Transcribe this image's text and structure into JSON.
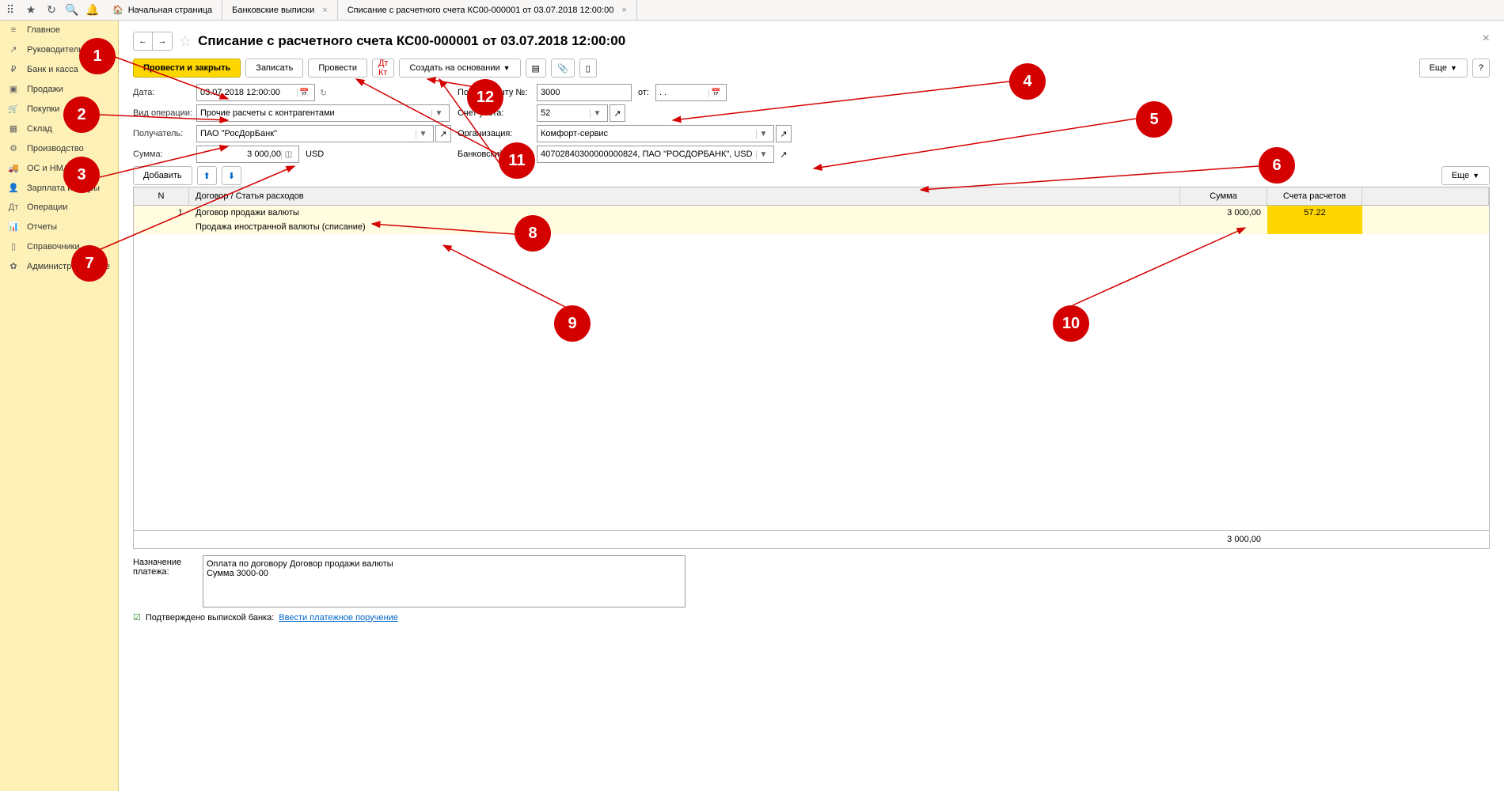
{
  "tabs": {
    "home": "Начальная страница",
    "t1": "Банковские выписки",
    "t2": "Списание с расчетного счета КС00-000001 от 03.07.2018 12:00:00"
  },
  "sidebar": [
    {
      "icon": "≡",
      "label": "Главное"
    },
    {
      "icon": "↗",
      "label": "Руководителю"
    },
    {
      "icon": "₽",
      "label": "Банк и касса"
    },
    {
      "icon": "▣",
      "label": "Продажи"
    },
    {
      "icon": "🛒",
      "label": "Покупки"
    },
    {
      "icon": "▦",
      "label": "Склад"
    },
    {
      "icon": "⚙",
      "label": "Производство"
    },
    {
      "icon": "🚚",
      "label": "ОС и НМА"
    },
    {
      "icon": "👤",
      "label": "Зарплата и кадры"
    },
    {
      "icon": "Дт",
      "label": "Операции"
    },
    {
      "icon": "📊",
      "label": "Отчеты"
    },
    {
      "icon": "▯",
      "label": "Справочники"
    },
    {
      "icon": "✿",
      "label": "Администрирование"
    }
  ],
  "title": "Списание с расчетного счета КС00-000001 от 03.07.2018 12:00:00",
  "toolbar": {
    "post_close": "Провести и закрыть",
    "save": "Записать",
    "post": "Провести",
    "create_based": "Создать на основании",
    "more": "Еще"
  },
  "form": {
    "date_lbl": "Дата:",
    "date": "03.07.2018 12:00:00",
    "op_lbl": "Вид операции:",
    "op": "Прочие расчеты с контрагентами",
    "recip_lbl": "Получатель:",
    "recip": "ПАО \"РосДорБанк\"",
    "sum_lbl": "Сумма:",
    "sum": "3 000,00",
    "currency": "USD",
    "docno_lbl": "По документу №:",
    "docno": "3000",
    "from_lbl": "от:",
    "from": ". .",
    "acc_lbl": "Счет учета:",
    "acc": "52",
    "org_lbl": "Организация:",
    "org": "Комфорт-сервис",
    "bank_lbl": "Банковский счет:",
    "bank": "40702840300000000824, ПАО \"РОСДОРБАНК\", USD"
  },
  "grid": {
    "add": "Добавить",
    "more": "Еще",
    "h_n": "N",
    "h_main": "Договор / Статья расходов",
    "h_sum": "Сумма",
    "h_acc": "Счета расчетов",
    "row": {
      "n": "1",
      "contract": "Договор продажи валюты",
      "expense": "Продажа иностранной валюты (списание)",
      "sum": "3 000,00",
      "acc": "57.22"
    },
    "total": "3 000,00"
  },
  "bottom": {
    "purpose_lbl": "Назначение платежа:",
    "purpose": "Оплата по договору Договор продажи валюты\nСумма 3000-00",
    "confirmed": "Подтверждено выпиской банка:",
    "link": "Ввести платежное поручение"
  },
  "help": "?",
  "ann": {
    "1": "1",
    "2": "2",
    "3": "3",
    "4": "4",
    "5": "5",
    "6": "6",
    "7": "7",
    "8": "8",
    "9": "9",
    "10": "10",
    "11": "11",
    "12": "12"
  }
}
